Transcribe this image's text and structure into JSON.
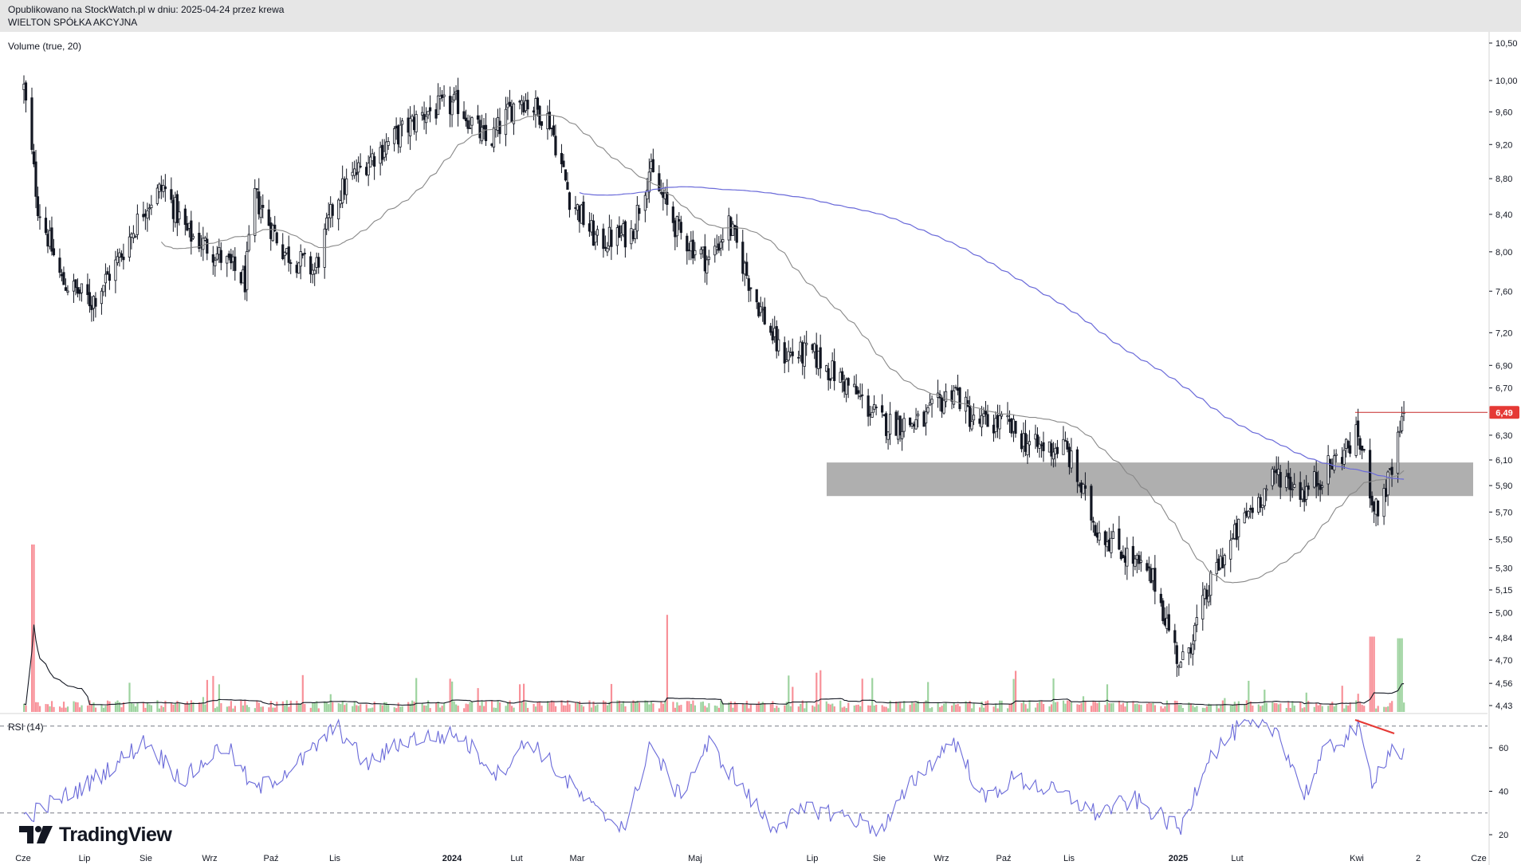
{
  "header": {
    "line1": "Opublikowano na StockWatch.pl w dniu: 2025-04-24 przez krewa",
    "line2": "WIELTON SPÓŁKA AKCYJNA"
  },
  "brand": {
    "name": "TradingView"
  },
  "colors": {
    "up": "#4caf50",
    "down": "#f23645",
    "ma_fast": "#888888",
    "ma_slow": "#6a6ad9",
    "rsi": "#6a6ad9",
    "zone": "#a6a6a6",
    "price_line": "#c62828",
    "last_badge": "#e53935",
    "divergence": "#e53935"
  },
  "chart_data": {
    "type": "candlestick",
    "price_axis": {
      "ticks": [
        "10,50",
        "10,00",
        "9,60",
        "9,20",
        "8,80",
        "8,40",
        "8,00",
        "7,60",
        "7,20",
        "6,90",
        "6,70",
        "6,30",
        "6,10",
        "5,90",
        "5,70",
        "5,50",
        "5,30",
        "5,15",
        "5,00",
        "4,84",
        "4,70",
        "4,56",
        "4,43"
      ],
      "scale": "log"
    },
    "time_axis": {
      "labels": [
        "Cze",
        "Lip",
        "Sie",
        "Wrz",
        "Paź",
        "Lis",
        "2024",
        "Lut",
        "Mar",
        "Maj",
        "Lip",
        "Sie",
        "Wrz",
        "Paź",
        "Lis",
        "2025",
        "Lut",
        "Kwi",
        "2",
        "Cze"
      ]
    },
    "last_price": {
      "label": "6,49",
      "value": 6.49
    },
    "support_zone": {
      "low": 5.82,
      "high": 6.08,
      "from": "2024-06",
      "to": "2025-05"
    },
    "price_path": [
      [
        "2023-06-01",
        9.9
      ],
      [
        "2023-06-08",
        8.5
      ],
      [
        "2023-06-20",
        7.7
      ],
      [
        "2023-07-05",
        7.5
      ],
      [
        "2023-07-18",
        7.9
      ],
      [
        "2023-08-01",
        8.5
      ],
      [
        "2023-08-10",
        8.7
      ],
      [
        "2023-08-22",
        8.2
      ],
      [
        "2023-09-05",
        8.0
      ],
      [
        "2023-09-20",
        7.7
      ],
      [
        "2023-09-25",
        8.6
      ],
      [
        "2023-10-10",
        8.0
      ],
      [
        "2023-10-25",
        7.8
      ],
      [
        "2023-11-05",
        8.6
      ],
      [
        "2023-11-20",
        9.0
      ],
      [
        "2023-12-05",
        9.3
      ],
      [
        "2023-12-20",
        9.6
      ],
      [
        "2024-01-05",
        9.7
      ],
      [
        "2024-01-20",
        9.2
      ],
      [
        "2024-02-05",
        9.8
      ],
      [
        "2024-02-20",
        9.5
      ],
      [
        "2024-03-01",
        8.6
      ],
      [
        "2024-03-15",
        8.1
      ],
      [
        "2024-04-01",
        8.2
      ],
      [
        "2024-04-10",
        8.9
      ],
      [
        "2024-04-25",
        8.2
      ],
      [
        "2024-05-10",
        7.9
      ],
      [
        "2024-05-20",
        8.3
      ],
      [
        "2024-06-01",
        7.6
      ],
      [
        "2024-06-15",
        7.0
      ],
      [
        "2024-07-01",
        7.0
      ],
      [
        "2024-07-20",
        6.7
      ],
      [
        "2024-08-05",
        6.4
      ],
      [
        "2024-08-25",
        6.4
      ],
      [
        "2024-09-10",
        6.7
      ],
      [
        "2024-09-20",
        6.4
      ],
      [
        "2024-10-05",
        6.4
      ],
      [
        "2024-10-20",
        6.2
      ],
      [
        "2024-11-05",
        6.2
      ],
      [
        "2024-11-20",
        5.6
      ],
      [
        "2024-12-05",
        5.4
      ],
      [
        "2024-12-20",
        5.2
      ],
      [
        "2025-01-02",
        4.65
      ],
      [
        "2025-01-20",
        5.3
      ],
      [
        "2025-02-05",
        5.7
      ],
      [
        "2025-02-20",
        6.0
      ],
      [
        "2025-03-05",
        5.85
      ],
      [
        "2025-03-15",
        6.0
      ],
      [
        "2025-04-01",
        6.3
      ],
      [
        "2025-04-10",
        5.7
      ],
      [
        "2025-04-18",
        6.0
      ],
      [
        "2025-04-24",
        6.49
      ]
    ],
    "volume": {
      "label": "Volume (true, 20)",
      "spikes": [
        [
          "2023-06-05",
          1.0
        ],
        [
          "2024-04-20",
          0.58
        ],
        [
          "2025-04-08",
          0.45
        ],
        [
          "2025-04-22",
          0.44
        ]
      ]
    },
    "rsi": {
      "label": "RSI (14)",
      "ticks": [
        "60",
        "40",
        "20"
      ],
      "levels": [
        70,
        30
      ],
      "path": [
        [
          "2023-06-01",
          28
        ],
        [
          "2023-07-01",
          42
        ],
        [
          "2023-08-01",
          63
        ],
        [
          "2023-08-20",
          45
        ],
        [
          "2023-09-10",
          62
        ],
        [
          "2023-09-25",
          40
        ],
        [
          "2023-10-20",
          55
        ],
        [
          "2023-11-05",
          70
        ],
        [
          "2023-11-20",
          52
        ],
        [
          "2023-12-10",
          64
        ],
        [
          "2024-01-05",
          66
        ],
        [
          "2024-01-25",
          48
        ],
        [
          "2024-02-10",
          64
        ],
        [
          "2024-02-28",
          45
        ],
        [
          "2024-03-15",
          30
        ],
        [
          "2024-03-30",
          24
        ],
        [
          "2024-04-10",
          62
        ],
        [
          "2024-04-25",
          38
        ],
        [
          "2024-05-10",
          62
        ],
        [
          "2024-06-10",
          24
        ],
        [
          "2024-07-01",
          32
        ],
        [
          "2024-07-20",
          28
        ],
        [
          "2024-08-05",
          22
        ],
        [
          "2024-08-20",
          44
        ],
        [
          "2024-09-10",
          64
        ],
        [
          "2024-09-25",
          36
        ],
        [
          "2024-10-10",
          46
        ],
        [
          "2024-11-05",
          38
        ],
        [
          "2024-11-20",
          30
        ],
        [
          "2024-12-10",
          36
        ],
        [
          "2025-01-02",
          22
        ],
        [
          "2025-01-15",
          55
        ],
        [
          "2025-02-01",
          70
        ],
        [
          "2025-02-20",
          68
        ],
        [
          "2025-03-05",
          38
        ],
        [
          "2025-03-15",
          58
        ],
        [
          "2025-04-01",
          69
        ],
        [
          "2025-04-08",
          45
        ],
        [
          "2025-04-18",
          60
        ],
        [
          "2025-04-24",
          56
        ]
      ]
    }
  }
}
